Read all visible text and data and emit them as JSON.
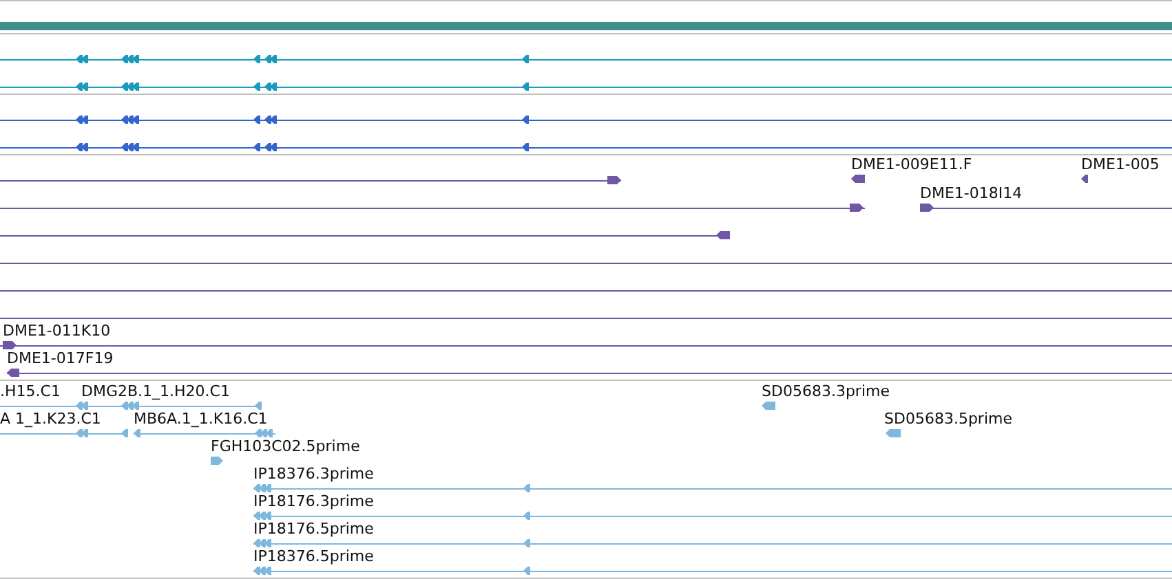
{
  "tracks": [
    {
      "color": "#1a9bbd",
      "features": [
        {
          "kind": "reverse"
        },
        {
          "kind": "reverse"
        }
      ]
    },
    {
      "color": "#3366cc",
      "features": [
        {
          "kind": "reverse"
        },
        {
          "kind": "reverse"
        }
      ]
    },
    {
      "color": "#6f57a5",
      "features": [
        {
          "kind": "forward"
        },
        {
          "label": "DME1-009E11.F",
          "kind": "reverse"
        },
        {
          "label": "DME1-005",
          "kind": "reverse"
        },
        {
          "kind": "forward"
        },
        {
          "label": "DME1-018I14",
          "kind": "forward"
        },
        {
          "kind": "reverse"
        },
        {
          "kind": "plain"
        },
        {
          "kind": "plain"
        },
        {
          "kind": "plain"
        },
        {
          "label": "DME1-011K10",
          "kind": "forward"
        },
        {
          "label": "DME1-017F19",
          "kind": "reverse"
        }
      ]
    },
    {
      "color": "#7fb8dc",
      "features": [
        {
          "label": ".H15.C1",
          "kind": "reverse"
        },
        {
          "label": "DMG2B.1_1.H20.C1",
          "kind": "reverse"
        },
        {
          "label": "SD05683.3prime",
          "kind": "reverse"
        },
        {
          "label": "A 1_1.K23.C1",
          "kind": "reverse"
        },
        {
          "label": "MB6A.1_1.K16.C1",
          "kind": "reverse"
        },
        {
          "label": "SD05683.5prime",
          "kind": "reverse"
        },
        {
          "label": "FGH103C02.5prime",
          "kind": "forward"
        },
        {
          "label": "IP18376.3prime",
          "kind": "reverse"
        },
        {
          "label": "IP18176.3prime",
          "kind": "reverse"
        },
        {
          "label": "IP18176.5prime",
          "kind": "reverse"
        },
        {
          "label": "IP18376.5prime",
          "kind": "reverse"
        }
      ]
    }
  ]
}
